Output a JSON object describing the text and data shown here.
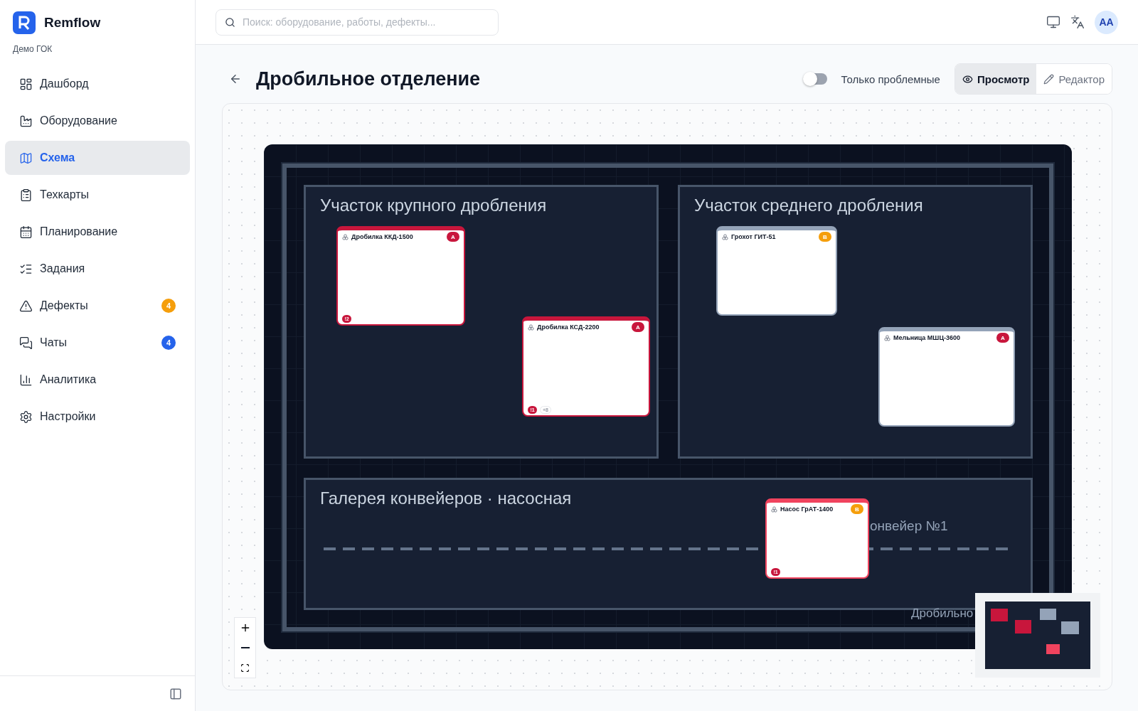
{
  "brand": {
    "name": "Remflow",
    "org": "Демо ГОК"
  },
  "nav": [
    {
      "label": "Дашборд",
      "selected": false
    },
    {
      "label": "Оборудование",
      "selected": false
    },
    {
      "label": "Схема",
      "selected": true
    },
    {
      "label": "Техкарты",
      "selected": false
    },
    {
      "label": "Планирование",
      "selected": false
    },
    {
      "label": "Задания",
      "selected": false
    },
    {
      "label": "Дефекты",
      "selected": false,
      "badge": "4",
      "color": "#f59e0b"
    },
    {
      "label": "Чаты",
      "selected": false,
      "badge": "4",
      "color": "#2563eb"
    },
    {
      "label": "Аналитика",
      "selected": false
    },
    {
      "label": "Настройки",
      "selected": false
    }
  ],
  "search": {
    "placeholder": "Поиск: оборудование, работы, дефекты..."
  },
  "user": {
    "initials": "AA"
  },
  "page": {
    "title": "Дробильное отделение"
  },
  "filter": {
    "label": "Только проблемные",
    "on": false
  },
  "modes": [
    {
      "label": "Просмотр",
      "selected": true
    },
    {
      "label": "Редактор",
      "selected": false
    }
  ],
  "scheme": {
    "zones": [
      {
        "title": "Участок крупного дробления"
      },
      {
        "title": "Участок среднего дробления"
      },
      {
        "title": "Галерея конвейеров · насосная"
      }
    ],
    "conveyor_label": "онвейер №1",
    "building_label": "Дробильно",
    "nodes": [
      {
        "name": "Дробилка ККД-1500",
        "priority": "A",
        "color": "#c8163c",
        "issues": "!2"
      },
      {
        "name": "Дробилка КСД-2200",
        "priority": "A",
        "color": "#c8163c",
        "issues": "!1",
        "extra": "+8"
      },
      {
        "name": "Грохот ГИТ-51",
        "priority": "B",
        "color": "#94a3b8"
      },
      {
        "name": "Мельница МШЦ-3600",
        "priority": "A",
        "color": "#94a3b8"
      },
      {
        "name": "Насос ГрАТ-1400",
        "priority": "B",
        "color": "#f0435e",
        "issues": "!1"
      }
    ]
  }
}
